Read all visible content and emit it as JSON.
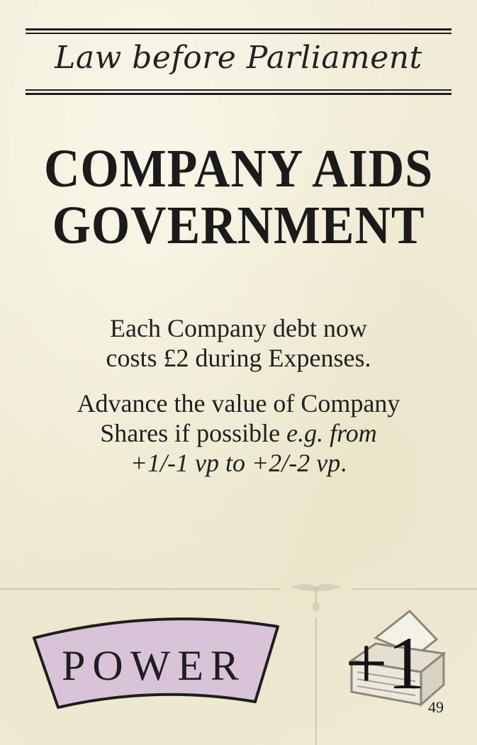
{
  "card": {
    "category": "Law before Parliament",
    "title_line1": "COMPANY AIDS",
    "title_line2": "GOVERNMENT",
    "effect1_line1": "Each Company debt now",
    "effect1_line2": "costs £2 during Expenses.",
    "effect2_line1": "Advance the value of Company",
    "effect2_line2_roman": "Shares if possible ",
    "effect2_line2_italic": "e.g. from",
    "effect2_line3_italic": "+1/-1 vp to +2/-2 vp",
    "effect2_line3_end": ".",
    "type_label": "POWER",
    "vp_value": "+1",
    "card_number": "49",
    "icons": {
      "ornament": "flourish-ornament-icon",
      "ballot": "ballot-box-icon"
    },
    "colors": {
      "banner_fill": "#d9c3d9",
      "ink": "#1b1b1b",
      "paper": "#f1ecd8"
    }
  }
}
